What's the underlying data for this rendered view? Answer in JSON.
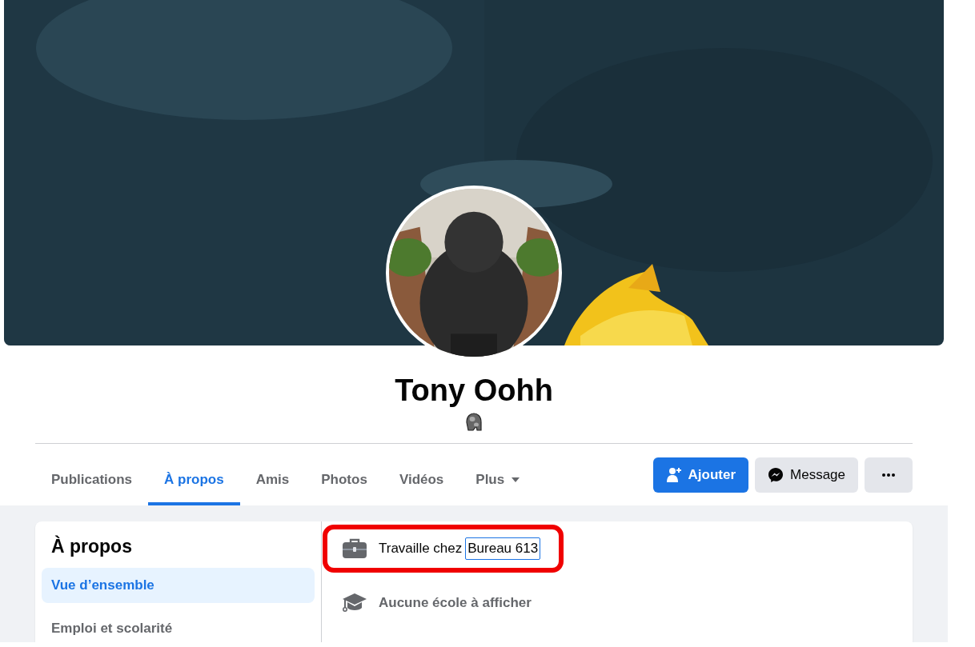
{
  "profile": {
    "name": "Tony Oohh"
  },
  "tabs": [
    {
      "label": "Publications",
      "selected": false,
      "kind": "plain"
    },
    {
      "label": "À propos",
      "selected": true,
      "kind": "plain"
    },
    {
      "label": "Amis",
      "selected": false,
      "kind": "plain"
    },
    {
      "label": "Photos",
      "selected": false,
      "kind": "plain"
    },
    {
      "label": "Vidéos",
      "selected": false,
      "kind": "plain"
    },
    {
      "label": "Plus",
      "selected": false,
      "kind": "dropdown"
    }
  ],
  "actions": [
    {
      "label": "Ajouter",
      "kind": "add"
    },
    {
      "label": "Message",
      "kind": "message"
    },
    {
      "kind": "more"
    }
  ],
  "about": {
    "title": "À propos",
    "nav": [
      {
        "label": "Vue d’ensemble",
        "selected": true
      },
      {
        "label": "Emploi et scolarité",
        "selected": false
      }
    ],
    "items": [
      {
        "kind": "work",
        "text": "Travaille chez",
        "link": "Bureau 613",
        "link_focused": true,
        "highlighted": true
      },
      {
        "kind": "school",
        "text": "Aucune école à afficher",
        "highlighted": false
      }
    ]
  }
}
